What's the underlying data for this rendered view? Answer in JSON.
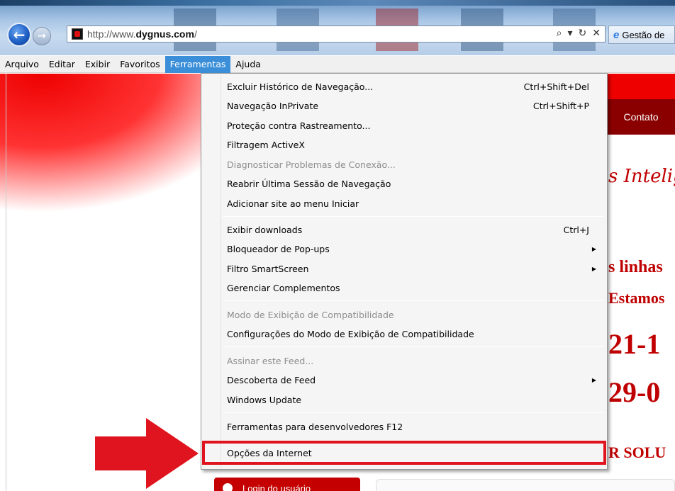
{
  "browser": {
    "url_prefix": "http://www.",
    "url_domain": "dygnus.com",
    "url_suffix": "/",
    "tab_title": "Gestão de",
    "search_icon": "⌕",
    "dropdown_icon": "▾",
    "refresh_icon": "↻",
    "stop_icon": "✕",
    "back_icon": "←",
    "forward_icon": "→"
  },
  "menubar": {
    "items": [
      "Arquivo",
      "Editar",
      "Exibir",
      "Favoritos",
      "Ferramentas",
      "Ajuda"
    ],
    "active": "Ferramentas"
  },
  "dropdown": {
    "items": [
      {
        "label": "Excluir Histórico de Navegação...",
        "shortcut": "Ctrl+Shift+Del"
      },
      {
        "label": "Navegação InPrivate",
        "shortcut": "Ctrl+Shift+P"
      },
      {
        "label": "Proteção contra Rastreamento..."
      },
      {
        "label": "Filtragem ActiveX"
      },
      {
        "label": "Diagnosticar Problemas de Conexão...",
        "disabled": true
      },
      {
        "label": "Reabrir Última Sessão de Navegação"
      },
      {
        "label": "Adicionar site ao menu Iniciar"
      },
      {
        "label": "Exibir downloads",
        "shortcut": "Ctrl+J"
      },
      {
        "label": "Bloqueador de Pop-ups",
        "submenu": true
      },
      {
        "label": "Filtro SmartScreen",
        "submenu": true
      },
      {
        "label": "Gerenciar Complementos"
      },
      {
        "label": "Modo de Exibição de Compatibilidade",
        "disabled": true
      },
      {
        "label": "Configurações do Modo de Exibição de Compatibilidade"
      },
      {
        "label": "Assinar este Feed...",
        "disabled": true
      },
      {
        "label": "Descoberta de Feed",
        "submenu": true
      },
      {
        "label": "Windows Update"
      },
      {
        "label": "Ferramentas para desenvolvedores F12"
      },
      {
        "label": "Opções da Internet",
        "highlighted": true
      }
    ]
  },
  "page": {
    "contato": "Contato",
    "text_1": "s Intelig",
    "text_2": "s linhas",
    "text_3": "Estamos",
    "text_4": "21-1",
    "text_5": "29-0",
    "text_6": "R SOLU",
    "login_label": "Login do usuário"
  },
  "colors": {
    "highlight_border": "#e0141e",
    "arrow": "#e0141e",
    "menu_active": "#3b8fd8",
    "brand_red": "#c00000"
  }
}
